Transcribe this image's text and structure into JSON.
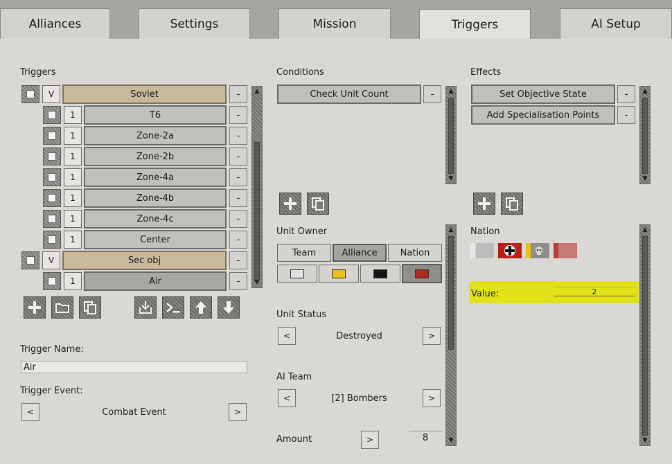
{
  "tabs": [
    {
      "label": "Alliances",
      "active": false
    },
    {
      "label": "Settings",
      "active": false
    },
    {
      "label": "Mission",
      "active": false
    },
    {
      "label": "Triggers",
      "active": true
    },
    {
      "label": "AI Setup",
      "active": false
    }
  ],
  "triggers": {
    "title": "Triggers",
    "groups": [
      {
        "toggle": "V",
        "name": "Soviet",
        "children": [
          {
            "count": "1",
            "name": "T6"
          },
          {
            "count": "1",
            "name": "Zone-2a"
          },
          {
            "count": "1",
            "name": "Zone-2b"
          },
          {
            "count": "1",
            "name": "Zone-4a"
          },
          {
            "count": "1",
            "name": "Zone-4b"
          },
          {
            "count": "1",
            "name": "Zone-4c"
          },
          {
            "count": "1",
            "name": "Center"
          }
        ]
      },
      {
        "toggle": "V",
        "name": "Sec obj",
        "children": [
          {
            "count": "1",
            "name": "Air"
          }
        ]
      }
    ],
    "remove_label": "-",
    "toolbar_icons": [
      "add-icon",
      "folder-icon",
      "copy-icon",
      "import-icon",
      "console-icon",
      "move-up-icon",
      "move-down-icon"
    ],
    "trigger_name_label": "Trigger Name:",
    "trigger_name_value": "Air",
    "trigger_event_label": "Trigger Event:",
    "trigger_event_value": "Combat Event",
    "prev": "<",
    "next": ">"
  },
  "conditions": {
    "title": "Conditions",
    "items": [
      "Check Unit Count"
    ],
    "remove_label": "-",
    "unit_owner_label": "Unit Owner",
    "owner_modes": [
      {
        "label": "Team",
        "selected": false
      },
      {
        "label": "Alliance",
        "selected": true
      },
      {
        "label": "Nation",
        "selected": false
      }
    ],
    "alliance_colors": [
      {
        "color": "#e0e0e0",
        "selected": false
      },
      {
        "color": "#e8c21a",
        "selected": false
      },
      {
        "color": "#141414",
        "selected": false
      },
      {
        "color": "#b3281f",
        "selected": true
      }
    ],
    "unit_status_label": "Unit Status",
    "unit_status_value": "Destroyed",
    "ai_team_label": "AI Team",
    "ai_team_value": "[2] Bombers",
    "amount_label": "Amount",
    "amount_value": "8",
    "prev": "<",
    "next": ">"
  },
  "effects": {
    "title": "Effects",
    "items": [
      "Set Objective State",
      "Add Specialisation Points"
    ],
    "remove_label": "-",
    "nation_label": "Nation",
    "value_label": "Value:",
    "value": "2",
    "highlight_color": "#e2e21a"
  }
}
